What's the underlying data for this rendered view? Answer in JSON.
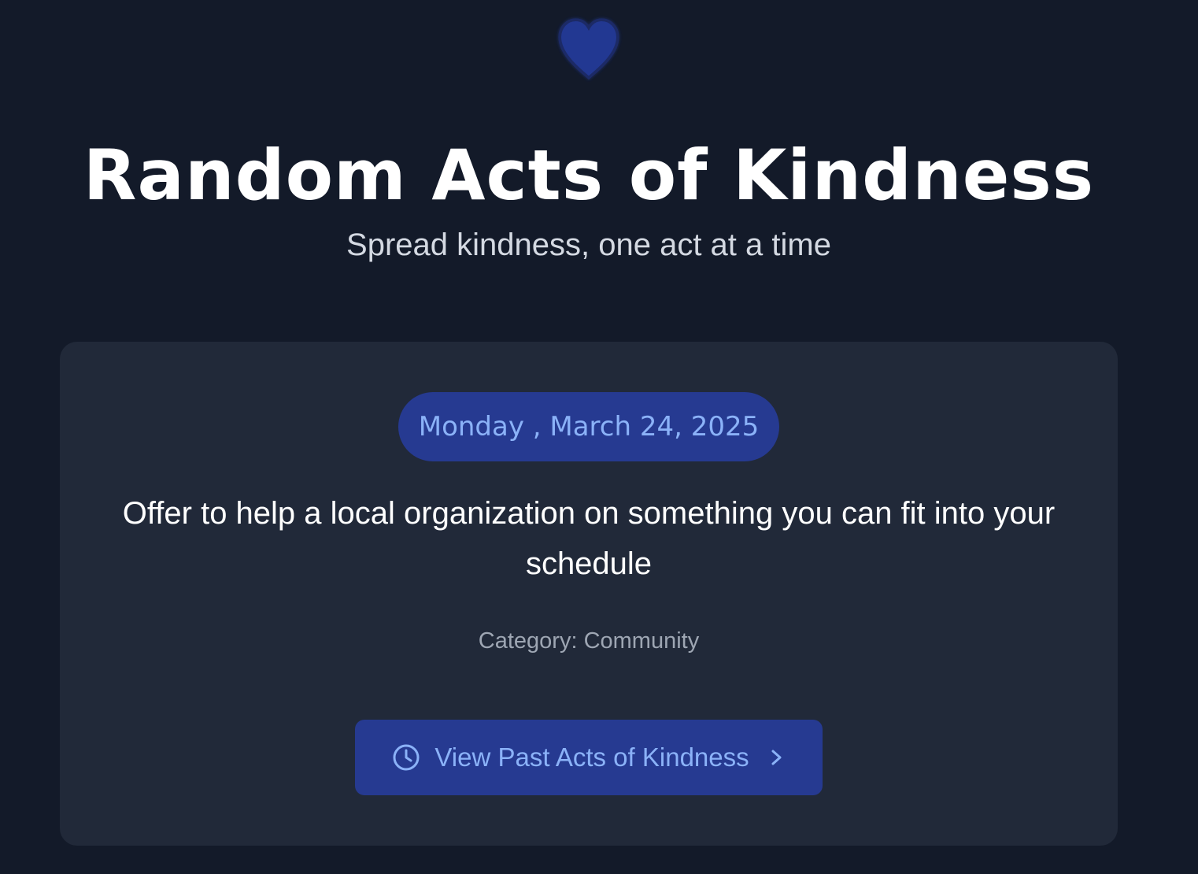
{
  "header": {
    "title": "Random Acts of Kindness",
    "subtitle": "Spread kindness, one act at a time",
    "logo_icon": "heart-icon"
  },
  "card": {
    "date": "Monday , March 24, 2025",
    "act": "Offer to help a local organization on something you can fit into your schedule",
    "category": "Category: Community",
    "button_label": "View Past Acts of Kindness",
    "button_icon": "clock-icon",
    "button_trailing_icon": "chevron-right-icon"
  },
  "colors": {
    "background": "#131a29",
    "card": "#212939",
    "accent": "#263a91",
    "accent_text": "#8bb2f8"
  }
}
